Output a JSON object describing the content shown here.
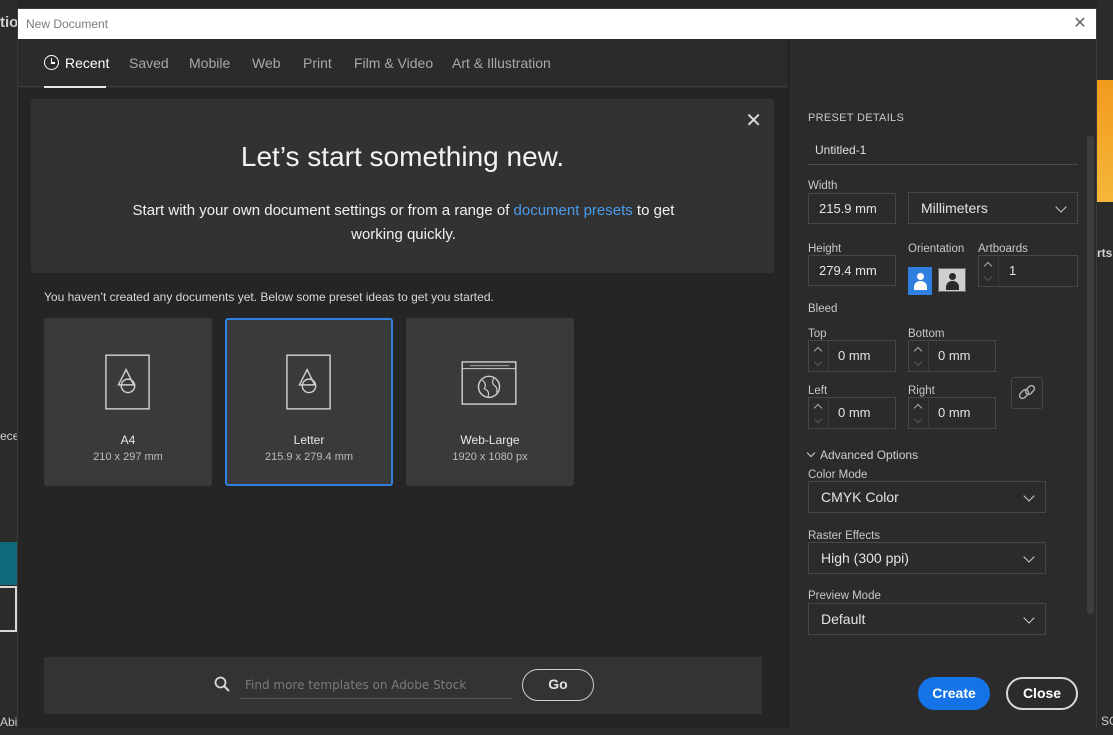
{
  "window": {
    "title": "New Document"
  },
  "tabs": [
    {
      "label": "Recent"
    },
    {
      "label": "Saved"
    },
    {
      "label": "Mobile"
    },
    {
      "label": "Web"
    },
    {
      "label": "Print"
    },
    {
      "label": "Film & Video"
    },
    {
      "label": "Art & Illustration"
    }
  ],
  "welcome": {
    "heading": "Let’s start something new.",
    "sub_before": "Start with your own document settings or from a range of ",
    "sub_link": "document presets",
    "sub_after": " to get working quickly."
  },
  "hint": "You haven’t created any documents yet. Below some preset ideas to get you started.",
  "presets": [
    {
      "name": "A4",
      "dims": "210 x 297 mm"
    },
    {
      "name": "Letter",
      "dims": "215.9 x 279.4 mm",
      "selected": true
    },
    {
      "name": "Web-Large",
      "dims": "1920 x 1080 px"
    }
  ],
  "search": {
    "placeholder": "Find more templates on Adobe Stock",
    "go_label": "Go"
  },
  "details": {
    "section_title": "PRESET DETAILS",
    "doc_name": "Untitled-1",
    "width_label": "Width",
    "width_value": "215.9 mm",
    "units": "Millimeters",
    "height_label": "Height",
    "height_value": "279.4 mm",
    "orientation_label": "Orientation",
    "artboards_label": "Artboards",
    "artboards_value": "1",
    "bleed_label": "Bleed",
    "top_label": "Top",
    "top_value": "0 mm",
    "bottom_label": "Bottom",
    "bottom_value": "0 mm",
    "left_label": "Left",
    "left_value": "0 mm",
    "right_label": "Right",
    "right_value": "0 mm",
    "advanced_label": "Advanced Options",
    "color_mode_label": "Color Mode",
    "color_mode_value": "CMYK Color",
    "raster_label": "Raster Effects",
    "raster_value": "High (300 ppi)",
    "preview_label": "Preview Mode",
    "preview_value": "Default",
    "create_label": "Create",
    "close_label": "Close"
  },
  "background": {
    "left_texts": [
      "tio",
      "ece",
      "Abi"
    ],
    "right_texts": [
      "rts",
      "SC"
    ]
  },
  "colors": {
    "accent": "#1473e6",
    "link": "#4a9bec"
  }
}
